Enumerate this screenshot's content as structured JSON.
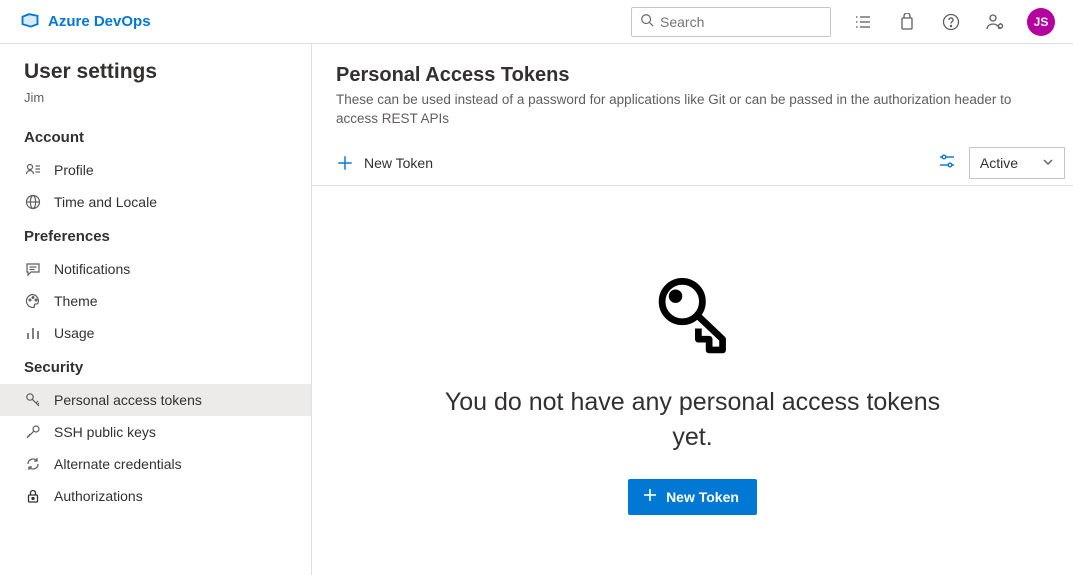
{
  "header": {
    "brand": "Azure DevOps",
    "search_placeholder": "Search",
    "avatar_initials": "JS"
  },
  "sidebar": {
    "title": "User settings",
    "username": "Jim",
    "groups": [
      {
        "title": "Account",
        "items": [
          {
            "label": "Profile",
            "icon": "person-card-icon",
            "selected": false
          },
          {
            "label": "Time and Locale",
            "icon": "globe-icon",
            "selected": false
          }
        ]
      },
      {
        "title": "Preferences",
        "items": [
          {
            "label": "Notifications",
            "icon": "chat-icon",
            "selected": false
          },
          {
            "label": "Theme",
            "icon": "palette-icon",
            "selected": false
          },
          {
            "label": "Usage",
            "icon": "bars-icon",
            "selected": false
          }
        ]
      },
      {
        "title": "Security",
        "items": [
          {
            "label": "Personal access tokens",
            "icon": "key-icon",
            "selected": true
          },
          {
            "label": "SSH public keys",
            "icon": "ssh-key-icon",
            "selected": false
          },
          {
            "label": "Alternate credentials",
            "icon": "sync-icon",
            "selected": false
          },
          {
            "label": "Authorizations",
            "icon": "lock-icon",
            "selected": false
          }
        ]
      }
    ]
  },
  "main": {
    "title": "Personal Access Tokens",
    "description": "These can be used instead of a password for applications like Git or can be passed in the authorization header to access REST APIs",
    "toolbar": {
      "new_token_label": "New Token",
      "status_filter_selected": "Active"
    },
    "empty_state": {
      "message": "You do not have any personal access tokens yet.",
      "button_label": "New Token"
    }
  }
}
